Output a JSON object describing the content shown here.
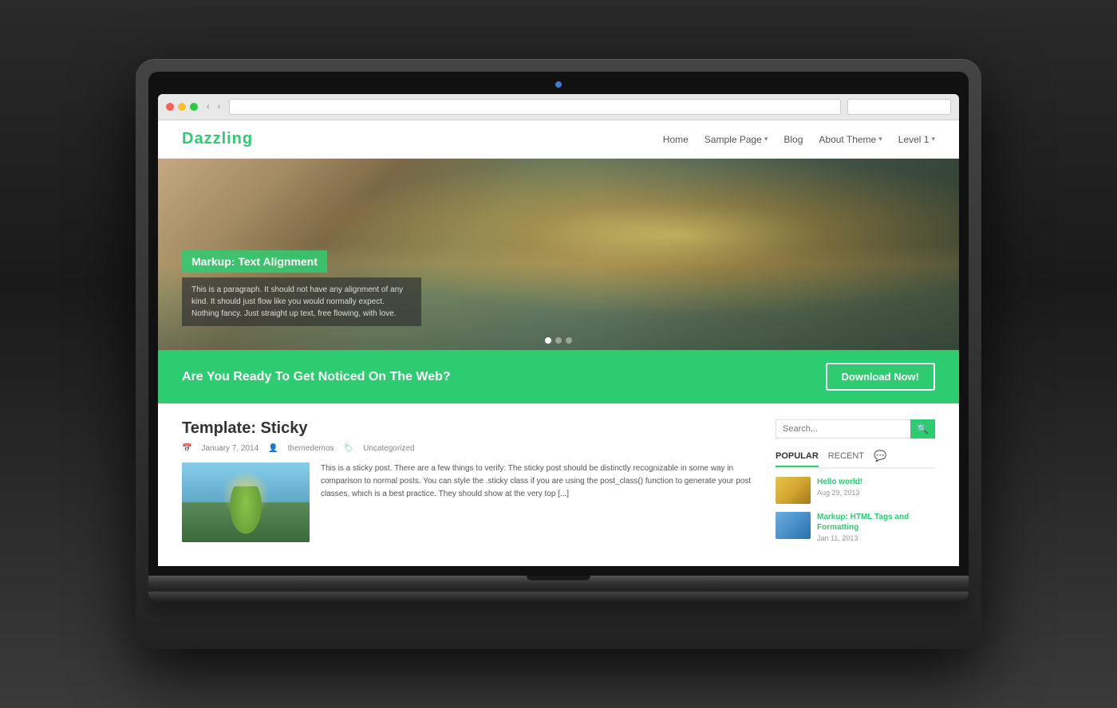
{
  "laptop": {
    "webcam_alt": "webcam"
  },
  "browser": {
    "address_placeholder": "",
    "search_placeholder": "",
    "nav_back": "‹",
    "nav_forward": "›",
    "nav_refresh": "⟳"
  },
  "site": {
    "logo": "Dazzling",
    "nav": {
      "items": [
        {
          "label": "Home",
          "has_dropdown": false
        },
        {
          "label": "Sample Page",
          "has_dropdown": true
        },
        {
          "label": "Blog",
          "has_dropdown": false
        },
        {
          "label": "About Theme",
          "has_dropdown": true
        },
        {
          "label": "Level 1",
          "has_dropdown": true
        }
      ]
    }
  },
  "hero": {
    "title": "Markup: Text Alignment",
    "description": "This is a paragraph. It should not have any alignment of any kind. It should just flow like you would normally expect. Nothing fancy. Just straight up text, free flowing, with love.",
    "dots": [
      {
        "active": true
      },
      {
        "active": false
      },
      {
        "active": false
      }
    ]
  },
  "cta": {
    "text": "Are You Ready To Get Noticed On The Web?",
    "button_label": "Download Now!"
  },
  "post": {
    "title": "Template: Sticky",
    "meta": {
      "date": "January 7, 2014",
      "author": "themedemos",
      "category": "Uncategorized"
    },
    "excerpt": "This is a sticky post. There are a few things to verify: The sticky post should be distinctly recognizable in some way in comparison to normal posts. You can style the .sticky class if you are using the post_class() function to generate your post classes, which is a best practice. They should show at the very top [...]"
  },
  "sidebar": {
    "search_placeholder": "Search...",
    "search_button_icon": "🔍",
    "tabs": [
      {
        "label": "POPULAR",
        "active": true
      },
      {
        "label": "RECENT",
        "active": false
      },
      {
        "label": "💬",
        "active": false,
        "is_icon": true
      }
    ],
    "posts": [
      {
        "title": "Hello world!",
        "date": "Aug 29, 2013",
        "thumb_class": "sidebar-thumb-1"
      },
      {
        "title": "Markup: HTML Tags and Formatting",
        "date": "Jan 11, 2013",
        "thumb_class": "sidebar-thumb-2"
      }
    ]
  }
}
